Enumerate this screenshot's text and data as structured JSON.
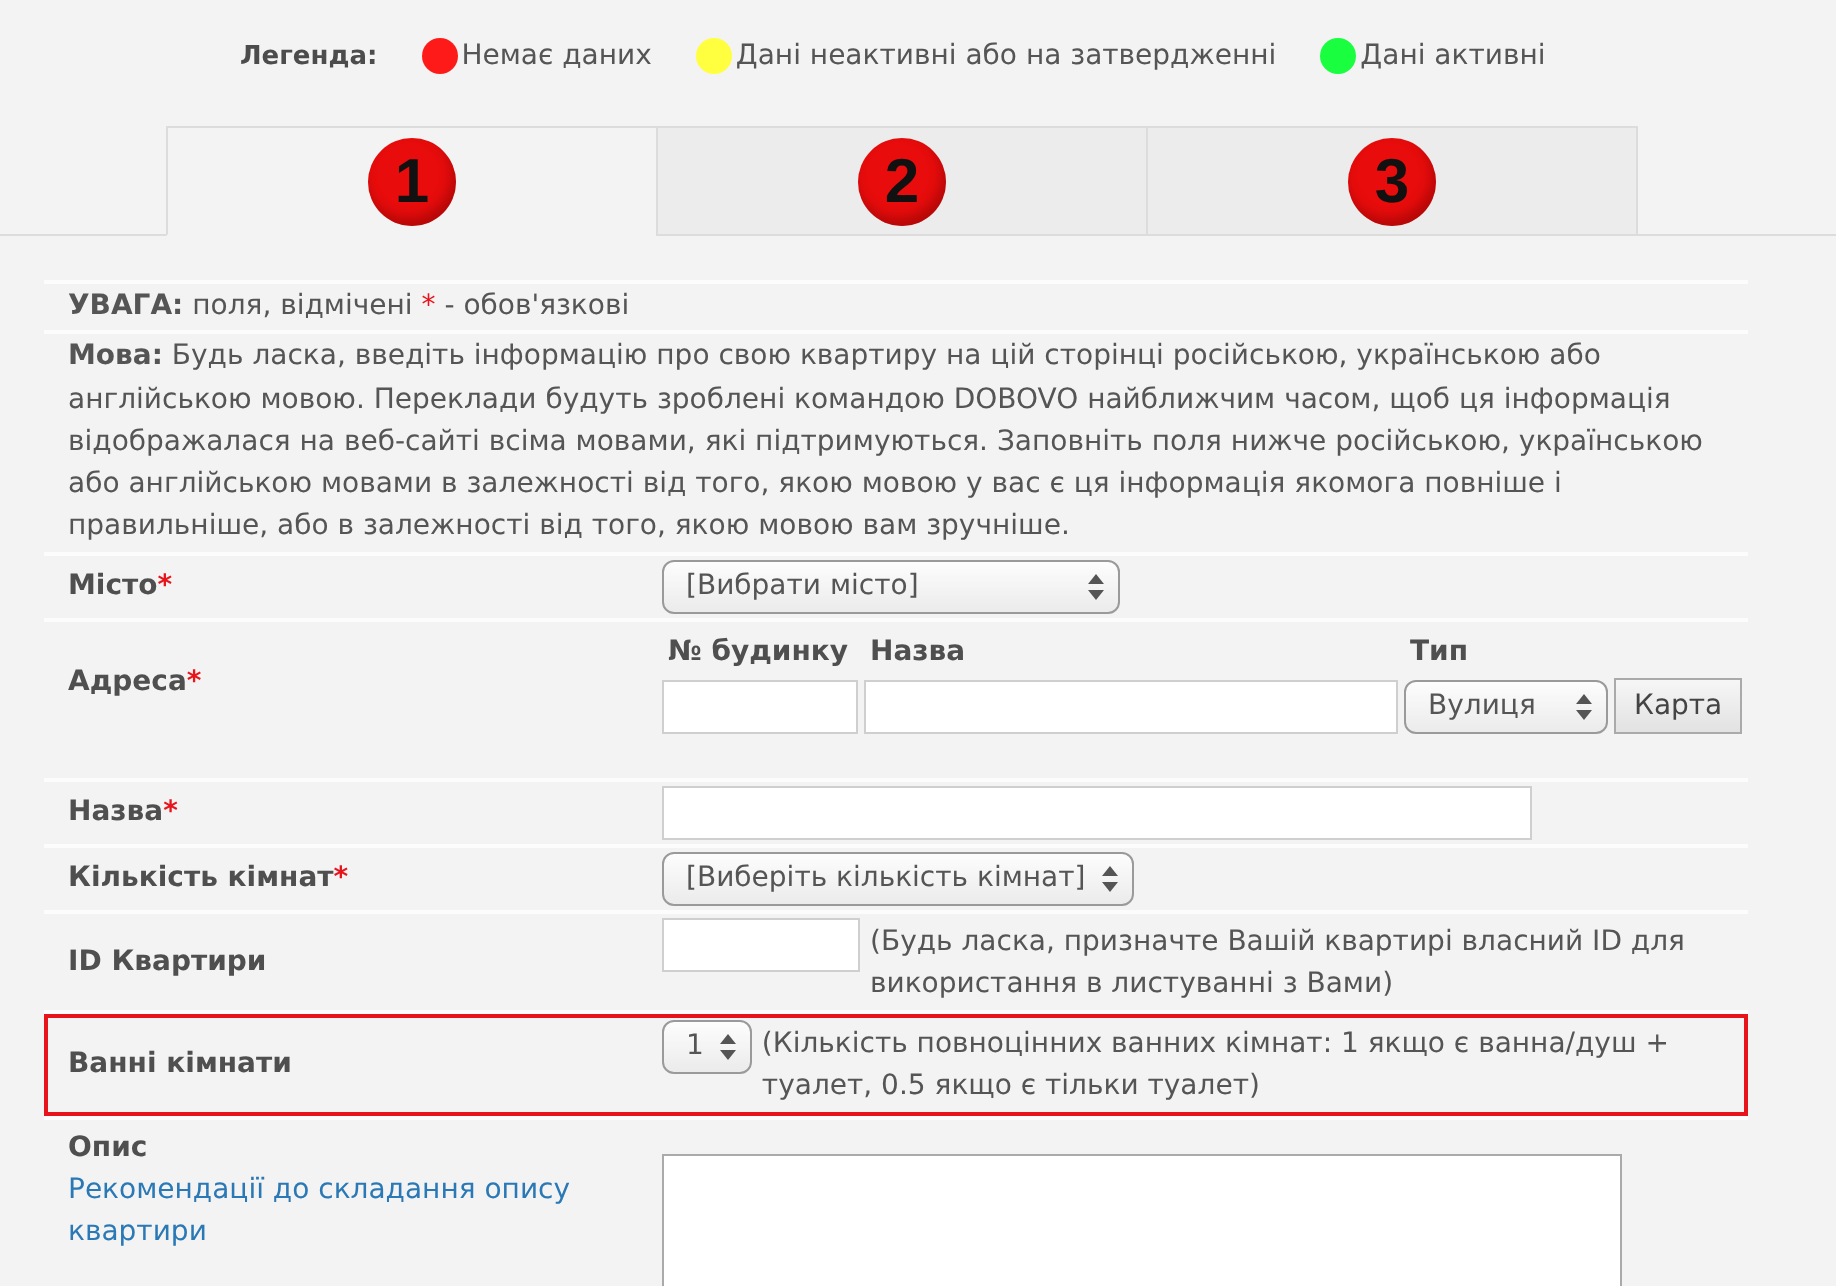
{
  "legend": {
    "title": "Легенда:",
    "items": [
      {
        "label": "Немає даних",
        "color": "#ff1a1a"
      },
      {
        "label": "Дані неактивні або на затвердженні",
        "color": "#ffff40"
      },
      {
        "label": "Дані активні",
        "color": "#19ff40"
      }
    ]
  },
  "tabs": [
    {
      "number": "1",
      "selected": true,
      "color": "#e80c0c"
    },
    {
      "number": "2",
      "selected": false,
      "color": "#e80c0c"
    },
    {
      "number": "3",
      "selected": false,
      "color": "#e80c0c"
    }
  ],
  "notice": {
    "lead": "**УВАГА:** поля, відмічені",
    "mark": "*",
    "tail": "- обов'язкові"
  },
  "language_note": "**Мова:** Будь ласка, введіть інформацію про свою квартиру на цій сторінці російською, українською або англійською мовою. Переклади будуть зроблені командою DOBOVO найближчим часом, щоб ця інформація відображалася на веб-сайті всіма мовами, які підтримуються. Заповніть поля нижче російською, українською або англійською мовами в залежності від того, якою мовою у вас є ця інформація якомога повніше і правильніше, або в залежності від того, якою мовою вам зручніше.",
  "fields": [
    {
      "kind": "select",
      "label": "Місто",
      "required_mark": "*",
      "value": "[Вибрати місто]",
      "highlighted": false
    },
    {
      "kind": "address",
      "label": "Адреса",
      "required_mark": "*",
      "parts": [
        {
          "kind": "input",
          "header": "№ будинку"
        },
        {
          "kind": "input",
          "header": "Назва"
        },
        {
          "kind": "select",
          "header": "Тип",
          "value": "Вулиця"
        }
      ],
      "button": "Карта",
      "highlighted": false
    },
    {
      "kind": "input",
      "label": "Назва",
      "required_mark": "*",
      "highlighted": false
    },
    {
      "kind": "select",
      "label": "Кількість кімнат",
      "required_mark": "*",
      "value": "[Виберіть кількість кімнат]",
      "highlighted": false
    },
    {
      "kind": "input",
      "label": "ID Квартири",
      "hint": "(Будь ласка, призначте Вашій квартирі власний ID для використання в листуванні з Вами)",
      "highlighted": false
    },
    {
      "kind": "select",
      "label": "Ванні кімнати",
      "value": "1",
      "hint": "(Кількість повноцінних ванних кімнат: 1 якщо є ванна/душ + туалет, 0.5 якщо є тільки туалет)",
      "highlighted": true
    },
    {
      "kind": "textarea",
      "label": "Опис",
      "link": "Рекомендації до складання опису квартири",
      "highlighted": false
    }
  ]
}
